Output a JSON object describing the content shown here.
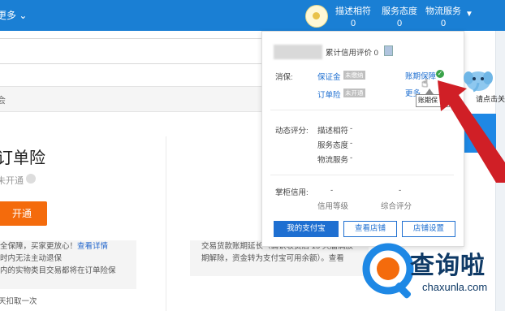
{
  "topbar": {
    "more_label": "更多",
    "scores": [
      {
        "label": "描述相符",
        "value": "0"
      },
      {
        "label": "服务态度",
        "value": "0"
      },
      {
        "label": "物流服务",
        "value": "0"
      }
    ],
    "colors": {
      "bar": "#1a7fd4"
    }
  },
  "background": {
    "gray_bar_text": "会",
    "card_title": "订单险",
    "card_status": "未开通",
    "open_button": "开通",
    "left_box_lines": [
      {
        "text": "全保障，买家更放心！",
        "link": "查看详情"
      },
      {
        "text": "时内无法主动退保",
        "link": ""
      },
      {
        "text": "内的实物类目交易都将在订单险保",
        "link": ""
      }
    ],
    "left_tail": "天扣取一次",
    "mid_box_lines": [
      "交易货款账期延长（确认收货后 15 天届满放",
      "期解除，资金转为支付宝可用余额）。查看"
    ]
  },
  "popup": {
    "credit_label": "累计信用评价 0",
    "guarantee": {
      "label": "消保:",
      "items": [
        {
          "name": "保证金",
          "tag": "未缴纳"
        },
        {
          "name": "账期保障",
          "tag": ""
        },
        {
          "name": "订单险",
          "tag": "未开通"
        },
        {
          "name": "更多",
          "tag": ""
        }
      ]
    },
    "dynamic": {
      "label": "动态评分:",
      "rows": [
        {
          "name": "描述相符",
          "value": "-"
        },
        {
          "name": "服务态度",
          "value": "-"
        },
        {
          "name": "物流服务",
          "value": "-"
        }
      ]
    },
    "shopkeeper": {
      "label": "掌柜信用:",
      "level_value": "-",
      "overall_value": "-",
      "level_label": "信用等级",
      "overall_label": "综合评分"
    },
    "buttons": {
      "alipay": "我的支付宝",
      "view_shop": "查看店铺",
      "shop_settings": "店铺设置"
    },
    "tooltip": "账期保",
    "colors": {
      "link": "#1e6fd1",
      "primary": "#1e6fd1",
      "check": "#3aa34a"
    }
  },
  "mascot": {
    "text": "请点击关"
  },
  "watermark": {
    "brand": "查询啦",
    "url": "chaxunla.com",
    "icon": "magnifier-q-icon"
  }
}
